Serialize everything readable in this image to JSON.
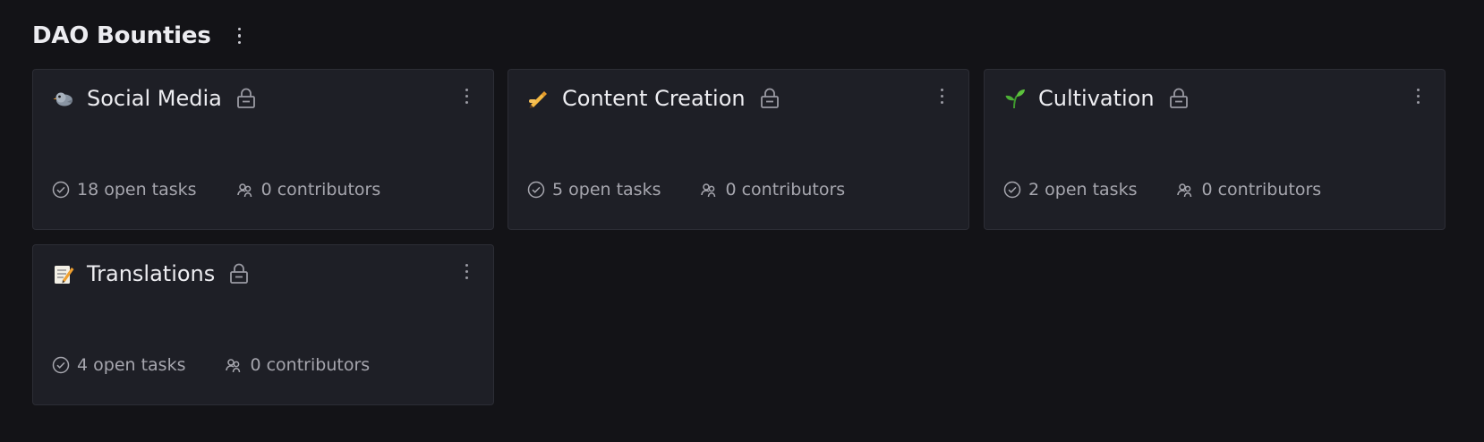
{
  "page": {
    "title": "DAO Bounties"
  },
  "colors": {
    "background": "#131317",
    "card": "#1e1f26",
    "card_border": "#2c2d35",
    "text_primary": "#ededf1",
    "text_secondary": "#a6a6ae"
  },
  "bounties": [
    {
      "emoji": "🐦",
      "emoji_icon": "bird-icon",
      "title": "Social Media",
      "open_tasks": "18 open tasks",
      "contributors": "0 contributors"
    },
    {
      "emoji": "✍️",
      "emoji_icon": "writing-hand-icon",
      "title": "Content Creation",
      "open_tasks": "5 open tasks",
      "contributors": "0 contributors"
    },
    {
      "emoji": "🌱",
      "emoji_icon": "seedling-icon",
      "title": "Cultivation",
      "open_tasks": "2 open tasks",
      "contributors": "0 contributors"
    },
    {
      "emoji": "📝",
      "emoji_icon": "memo-icon",
      "title": "Translations",
      "open_tasks": "4 open tasks",
      "contributors": "0 contributors"
    }
  ]
}
